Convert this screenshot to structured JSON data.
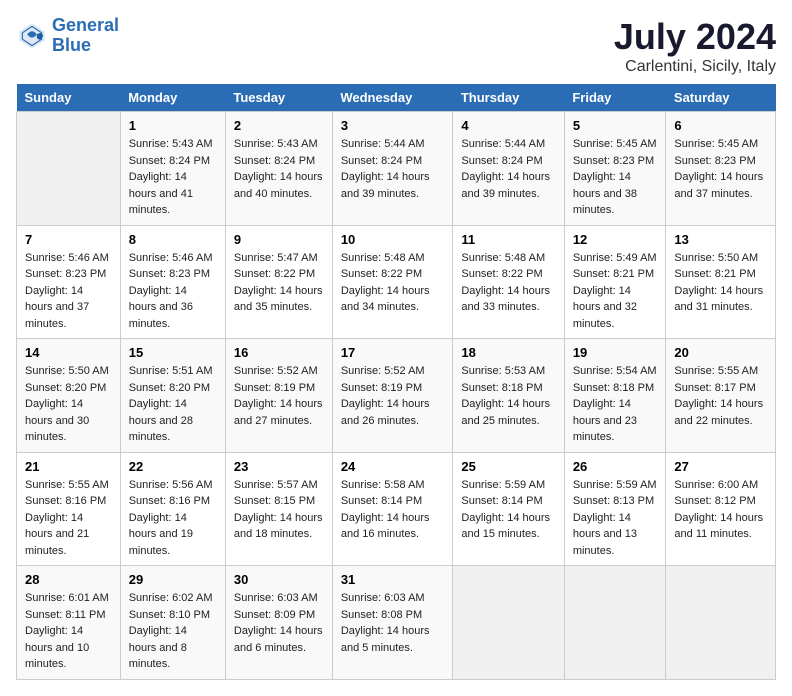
{
  "logo": {
    "line1": "General",
    "line2": "Blue"
  },
  "title": "July 2024",
  "subtitle": "Carlentini, Sicily, Italy",
  "days_of_week": [
    "Sunday",
    "Monday",
    "Tuesday",
    "Wednesday",
    "Thursday",
    "Friday",
    "Saturday"
  ],
  "weeks": [
    [
      {
        "day": "",
        "sunrise": "",
        "sunset": "",
        "daylight": ""
      },
      {
        "day": "1",
        "sunrise": "Sunrise: 5:43 AM",
        "sunset": "Sunset: 8:24 PM",
        "daylight": "Daylight: 14 hours and 41 minutes."
      },
      {
        "day": "2",
        "sunrise": "Sunrise: 5:43 AM",
        "sunset": "Sunset: 8:24 PM",
        "daylight": "Daylight: 14 hours and 40 minutes."
      },
      {
        "day": "3",
        "sunrise": "Sunrise: 5:44 AM",
        "sunset": "Sunset: 8:24 PM",
        "daylight": "Daylight: 14 hours and 39 minutes."
      },
      {
        "day": "4",
        "sunrise": "Sunrise: 5:44 AM",
        "sunset": "Sunset: 8:24 PM",
        "daylight": "Daylight: 14 hours and 39 minutes."
      },
      {
        "day": "5",
        "sunrise": "Sunrise: 5:45 AM",
        "sunset": "Sunset: 8:23 PM",
        "daylight": "Daylight: 14 hours and 38 minutes."
      },
      {
        "day": "6",
        "sunrise": "Sunrise: 5:45 AM",
        "sunset": "Sunset: 8:23 PM",
        "daylight": "Daylight: 14 hours and 37 minutes."
      }
    ],
    [
      {
        "day": "7",
        "sunrise": "Sunrise: 5:46 AM",
        "sunset": "Sunset: 8:23 PM",
        "daylight": "Daylight: 14 hours and 37 minutes."
      },
      {
        "day": "8",
        "sunrise": "Sunrise: 5:46 AM",
        "sunset": "Sunset: 8:23 PM",
        "daylight": "Daylight: 14 hours and 36 minutes."
      },
      {
        "day": "9",
        "sunrise": "Sunrise: 5:47 AM",
        "sunset": "Sunset: 8:22 PM",
        "daylight": "Daylight: 14 hours and 35 minutes."
      },
      {
        "day": "10",
        "sunrise": "Sunrise: 5:48 AM",
        "sunset": "Sunset: 8:22 PM",
        "daylight": "Daylight: 14 hours and 34 minutes."
      },
      {
        "day": "11",
        "sunrise": "Sunrise: 5:48 AM",
        "sunset": "Sunset: 8:22 PM",
        "daylight": "Daylight: 14 hours and 33 minutes."
      },
      {
        "day": "12",
        "sunrise": "Sunrise: 5:49 AM",
        "sunset": "Sunset: 8:21 PM",
        "daylight": "Daylight: 14 hours and 32 minutes."
      },
      {
        "day": "13",
        "sunrise": "Sunrise: 5:50 AM",
        "sunset": "Sunset: 8:21 PM",
        "daylight": "Daylight: 14 hours and 31 minutes."
      }
    ],
    [
      {
        "day": "14",
        "sunrise": "Sunrise: 5:50 AM",
        "sunset": "Sunset: 8:20 PM",
        "daylight": "Daylight: 14 hours and 30 minutes."
      },
      {
        "day": "15",
        "sunrise": "Sunrise: 5:51 AM",
        "sunset": "Sunset: 8:20 PM",
        "daylight": "Daylight: 14 hours and 28 minutes."
      },
      {
        "day": "16",
        "sunrise": "Sunrise: 5:52 AM",
        "sunset": "Sunset: 8:19 PM",
        "daylight": "Daylight: 14 hours and 27 minutes."
      },
      {
        "day": "17",
        "sunrise": "Sunrise: 5:52 AM",
        "sunset": "Sunset: 8:19 PM",
        "daylight": "Daylight: 14 hours and 26 minutes."
      },
      {
        "day": "18",
        "sunrise": "Sunrise: 5:53 AM",
        "sunset": "Sunset: 8:18 PM",
        "daylight": "Daylight: 14 hours and 25 minutes."
      },
      {
        "day": "19",
        "sunrise": "Sunrise: 5:54 AM",
        "sunset": "Sunset: 8:18 PM",
        "daylight": "Daylight: 14 hours and 23 minutes."
      },
      {
        "day": "20",
        "sunrise": "Sunrise: 5:55 AM",
        "sunset": "Sunset: 8:17 PM",
        "daylight": "Daylight: 14 hours and 22 minutes."
      }
    ],
    [
      {
        "day": "21",
        "sunrise": "Sunrise: 5:55 AM",
        "sunset": "Sunset: 8:16 PM",
        "daylight": "Daylight: 14 hours and 21 minutes."
      },
      {
        "day": "22",
        "sunrise": "Sunrise: 5:56 AM",
        "sunset": "Sunset: 8:16 PM",
        "daylight": "Daylight: 14 hours and 19 minutes."
      },
      {
        "day": "23",
        "sunrise": "Sunrise: 5:57 AM",
        "sunset": "Sunset: 8:15 PM",
        "daylight": "Daylight: 14 hours and 18 minutes."
      },
      {
        "day": "24",
        "sunrise": "Sunrise: 5:58 AM",
        "sunset": "Sunset: 8:14 PM",
        "daylight": "Daylight: 14 hours and 16 minutes."
      },
      {
        "day": "25",
        "sunrise": "Sunrise: 5:59 AM",
        "sunset": "Sunset: 8:14 PM",
        "daylight": "Daylight: 14 hours and 15 minutes."
      },
      {
        "day": "26",
        "sunrise": "Sunrise: 5:59 AM",
        "sunset": "Sunset: 8:13 PM",
        "daylight": "Daylight: 14 hours and 13 minutes."
      },
      {
        "day": "27",
        "sunrise": "Sunrise: 6:00 AM",
        "sunset": "Sunset: 8:12 PM",
        "daylight": "Daylight: 14 hours and 11 minutes."
      }
    ],
    [
      {
        "day": "28",
        "sunrise": "Sunrise: 6:01 AM",
        "sunset": "Sunset: 8:11 PM",
        "daylight": "Daylight: 14 hours and 10 minutes."
      },
      {
        "day": "29",
        "sunrise": "Sunrise: 6:02 AM",
        "sunset": "Sunset: 8:10 PM",
        "daylight": "Daylight: 14 hours and 8 minutes."
      },
      {
        "day": "30",
        "sunrise": "Sunrise: 6:03 AM",
        "sunset": "Sunset: 8:09 PM",
        "daylight": "Daylight: 14 hours and 6 minutes."
      },
      {
        "day": "31",
        "sunrise": "Sunrise: 6:03 AM",
        "sunset": "Sunset: 8:08 PM",
        "daylight": "Daylight: 14 hours and 5 minutes."
      },
      {
        "day": "",
        "sunrise": "",
        "sunset": "",
        "daylight": ""
      },
      {
        "day": "",
        "sunrise": "",
        "sunset": "",
        "daylight": ""
      },
      {
        "day": "",
        "sunrise": "",
        "sunset": "",
        "daylight": ""
      }
    ]
  ]
}
